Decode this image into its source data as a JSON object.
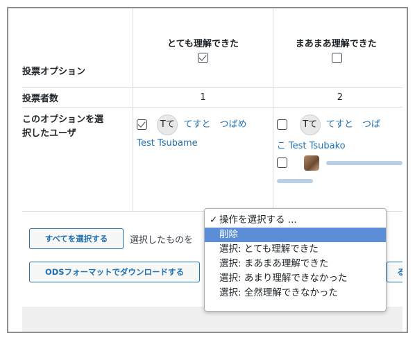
{
  "table": {
    "header_label": "投票オプション",
    "options": [
      {
        "label": "とても理解できた",
        "checked": true
      },
      {
        "label": "まあまあ理解できた",
        "checked": false
      }
    ],
    "voter_count_label": "投票者数",
    "voter_counts": [
      "1",
      "2"
    ],
    "users_label_line1": "このオプションを選",
    "users_label_line2": "択したユーザ",
    "col1_users": [
      {
        "checked": true,
        "avatar_text": "Tて",
        "name_part1": "てすと　つばめ",
        "name_part2": "Test Tsubame"
      }
    ],
    "col2_users": [
      {
        "checked": false,
        "avatar_text": "Tて",
        "name_part1": "てすと　つば",
        "name_part2": "こ Test Tsubako"
      },
      {
        "checked": false
      }
    ]
  },
  "actions": {
    "select_all_label": "すべてを選択する",
    "selected_label": "選択したものを",
    "ods_label": "ODSフォーマットでダウンロードする",
    "partial_button_label": "る"
  },
  "dropdown": {
    "check_mark": "✓",
    "items": [
      {
        "label": "操作を選択する ...",
        "current": true,
        "highlighted": false
      },
      {
        "label": "削除",
        "current": false,
        "highlighted": true
      },
      {
        "label": "選択: とても理解できた",
        "current": false,
        "highlighted": false
      },
      {
        "label": "選択: まあまあ理解できた",
        "current": false,
        "highlighted": false
      },
      {
        "label": "選択: あまり理解できなかった",
        "current": false,
        "highlighted": false
      },
      {
        "label": "選択: 全然理解できなかった",
        "current": false,
        "highlighted": false
      }
    ]
  },
  "colors": {
    "link": "#2271b1",
    "highlight": "#5b8ed6",
    "border": "#dcdcde"
  }
}
